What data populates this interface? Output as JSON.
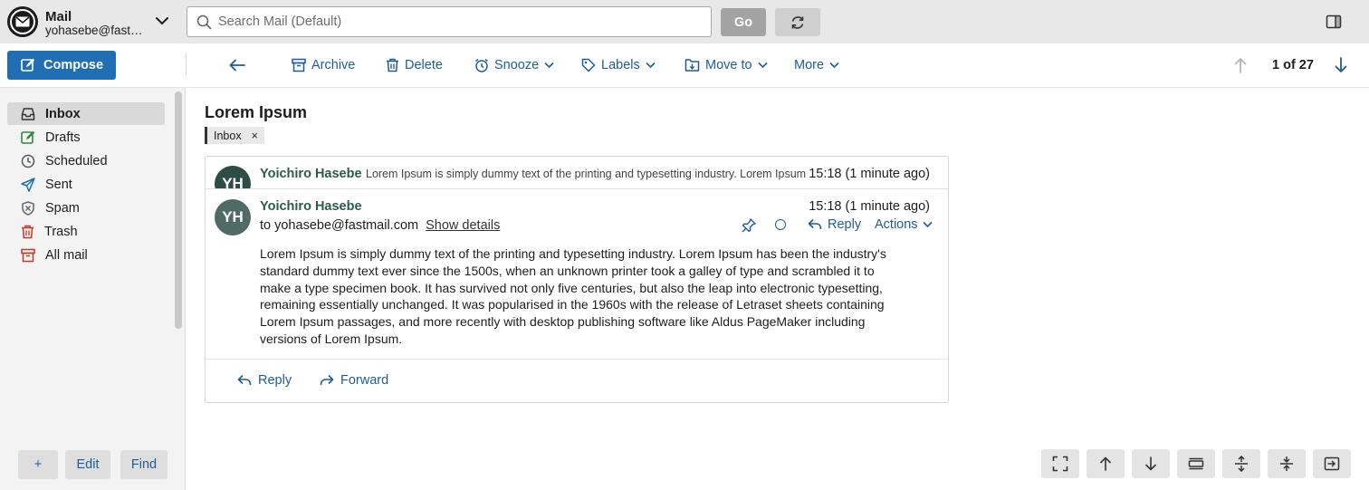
{
  "app": {
    "name": "Mail",
    "account": "yohasebe@fastmail.com",
    "logo_icon": "mail-envelope-icon"
  },
  "search": {
    "placeholder": "Search Mail (Default)",
    "value": "",
    "go_label": "Go",
    "refresh_icon": "refresh-icon"
  },
  "toolbar": {
    "compose_label": "Compose",
    "back_icon": "arrow-left-icon",
    "archive_label": "Archive",
    "delete_label": "Delete",
    "snooze_label": "Snooze",
    "labels_label": "Labels",
    "move_label": "Move to",
    "more_label": "More",
    "counter": "1 of 27"
  },
  "sidebar": {
    "items": [
      {
        "label": "Inbox",
        "icon": "inbox-icon",
        "active": true
      },
      {
        "label": "Drafts",
        "icon": "drafts-icon",
        "active": false
      },
      {
        "label": "Scheduled",
        "icon": "clock-icon",
        "active": false
      },
      {
        "label": "Sent",
        "icon": "paper-plane-icon",
        "active": false
      },
      {
        "label": "Spam",
        "icon": "shield-icon",
        "active": false
      },
      {
        "label": "Trash",
        "icon": "trash-icon",
        "active": false
      },
      {
        "label": "All mail",
        "icon": "archive-box-icon",
        "active": false
      }
    ],
    "add_label": "+",
    "edit_label": "Edit",
    "find_label": "Find"
  },
  "thread": {
    "subject": "Lorem Ipsum",
    "label_chip": "Inbox",
    "label_close": "×",
    "collapsed": {
      "initials": "YH",
      "sender": "Yoichiro Hasebe",
      "preview": "Lorem Ipsum is simply dummy text of the printing and typesetting industry. Lorem Ipsum",
      "time": "15:18 (1 minute ago)"
    },
    "message": {
      "initials": "YH",
      "sender": "Yoichiro Hasebe",
      "time": "15:18 (1 minute ago)",
      "to": "to yohasebe@fastmail.com",
      "show_details": "Show details",
      "reply_label": "Reply",
      "actions_label": "Actions",
      "body": "Lorem Ipsum is simply dummy text of the printing and typesetting industry. Lorem Ipsum has been the industry's standard dummy text ever since the 1500s, when an unknown printer took a galley of type and scrambled it to make a type specimen book. It has survived not only five centuries, but also the leap into electronic typesetting, remaining essentially unchanged. It was popularised in the 1960s with the release of Letraset sheets containing Lorem Ipsum passages, and more recently with desktop publishing software like Aldus PageMaker including versions of Lorem Ipsum.",
      "footer_reply": "Reply",
      "footer_forward": "Forward"
    }
  },
  "colors": {
    "accent": "#1f6fb2",
    "link": "#1f5c96",
    "sender": "#2b5a4e",
    "avatar": "#2e4d44"
  }
}
